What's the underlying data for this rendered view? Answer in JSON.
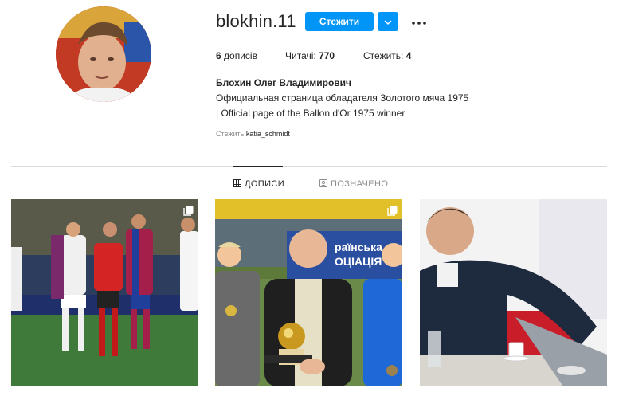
{
  "profile": {
    "username": "blokhin.11",
    "follow_label": "Стежити",
    "full_name": "Блохин Олег Владимирович",
    "bio_lines": [
      "Официальная страница обладателя Золотого мяча 1975",
      "| Official page of the Ballon d'Or 1975 winner"
    ],
    "followed_by_prefix": "Стежить",
    "followed_by_user": "katia_schmidt"
  },
  "stats": {
    "posts_value": "6",
    "posts_label": "дописів",
    "followers_label": "Читачі:",
    "followers_value": "770",
    "following_label": "Стежить:",
    "following_value": "4"
  },
  "tabs": [
    {
      "label": "ДОПИСИ",
      "icon": "grid-icon",
      "active": true
    },
    {
      "label": "ПОЗНАЧЕНО",
      "icon": "tagged-icon",
      "active": false
    }
  ],
  "posts": [
    {
      "scene": "football-match",
      "multi": true
    },
    {
      "scene": "award-ceremony",
      "multi": true
    },
    {
      "scene": "interview",
      "multi": false
    }
  ],
  "post2_banner_text": [
    "раїнська",
    "ОЦІАЦІЯ"
  ],
  "colors": {
    "accent": "#0095f6",
    "text": "#262626",
    "muted": "#8e8e8e",
    "divider": "#dbdbdb"
  }
}
